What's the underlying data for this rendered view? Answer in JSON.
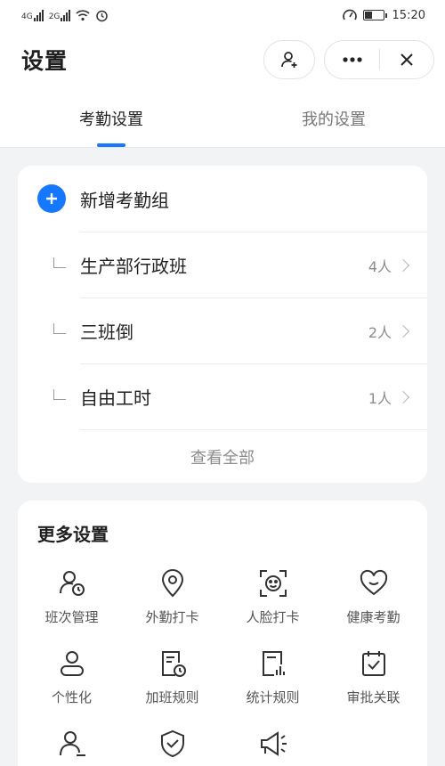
{
  "status_bar": {
    "net1": "4G",
    "net2": "2G",
    "time": "15:20"
  },
  "header": {
    "title": "设置"
  },
  "tabs": [
    {
      "label": "考勤设置",
      "active": true
    },
    {
      "label": "我的设置",
      "active": false
    }
  ],
  "attendance": {
    "add_label": "新增考勤组",
    "groups": [
      {
        "name": "生产部行政班",
        "count": "4人"
      },
      {
        "name": "三班倒",
        "count": "2人"
      },
      {
        "name": "自由工时",
        "count": "1人"
      }
    ],
    "view_all": "查看全部"
  },
  "more": {
    "title": "更多设置",
    "items": [
      {
        "label": "班次管理",
        "icon": "shift-icon"
      },
      {
        "label": "外勤打卡",
        "icon": "location-pin-icon"
      },
      {
        "label": "人脸打卡",
        "icon": "face-scan-icon"
      },
      {
        "label": "健康考勤",
        "icon": "heart-icon"
      },
      {
        "label": "个性化",
        "icon": "user-icon"
      },
      {
        "label": "加班规则",
        "icon": "overtime-doc-icon"
      },
      {
        "label": "统计规则",
        "icon": "stats-doc-icon"
      },
      {
        "label": "审批关联",
        "icon": "calendar-check-icon"
      },
      {
        "label": "",
        "icon": "user-settings-icon"
      },
      {
        "label": "",
        "icon": "shield-check-icon"
      },
      {
        "label": "",
        "icon": "megaphone-icon"
      }
    ]
  },
  "colors": {
    "accent": "#1677ff",
    "background": "#f2f3f5"
  }
}
